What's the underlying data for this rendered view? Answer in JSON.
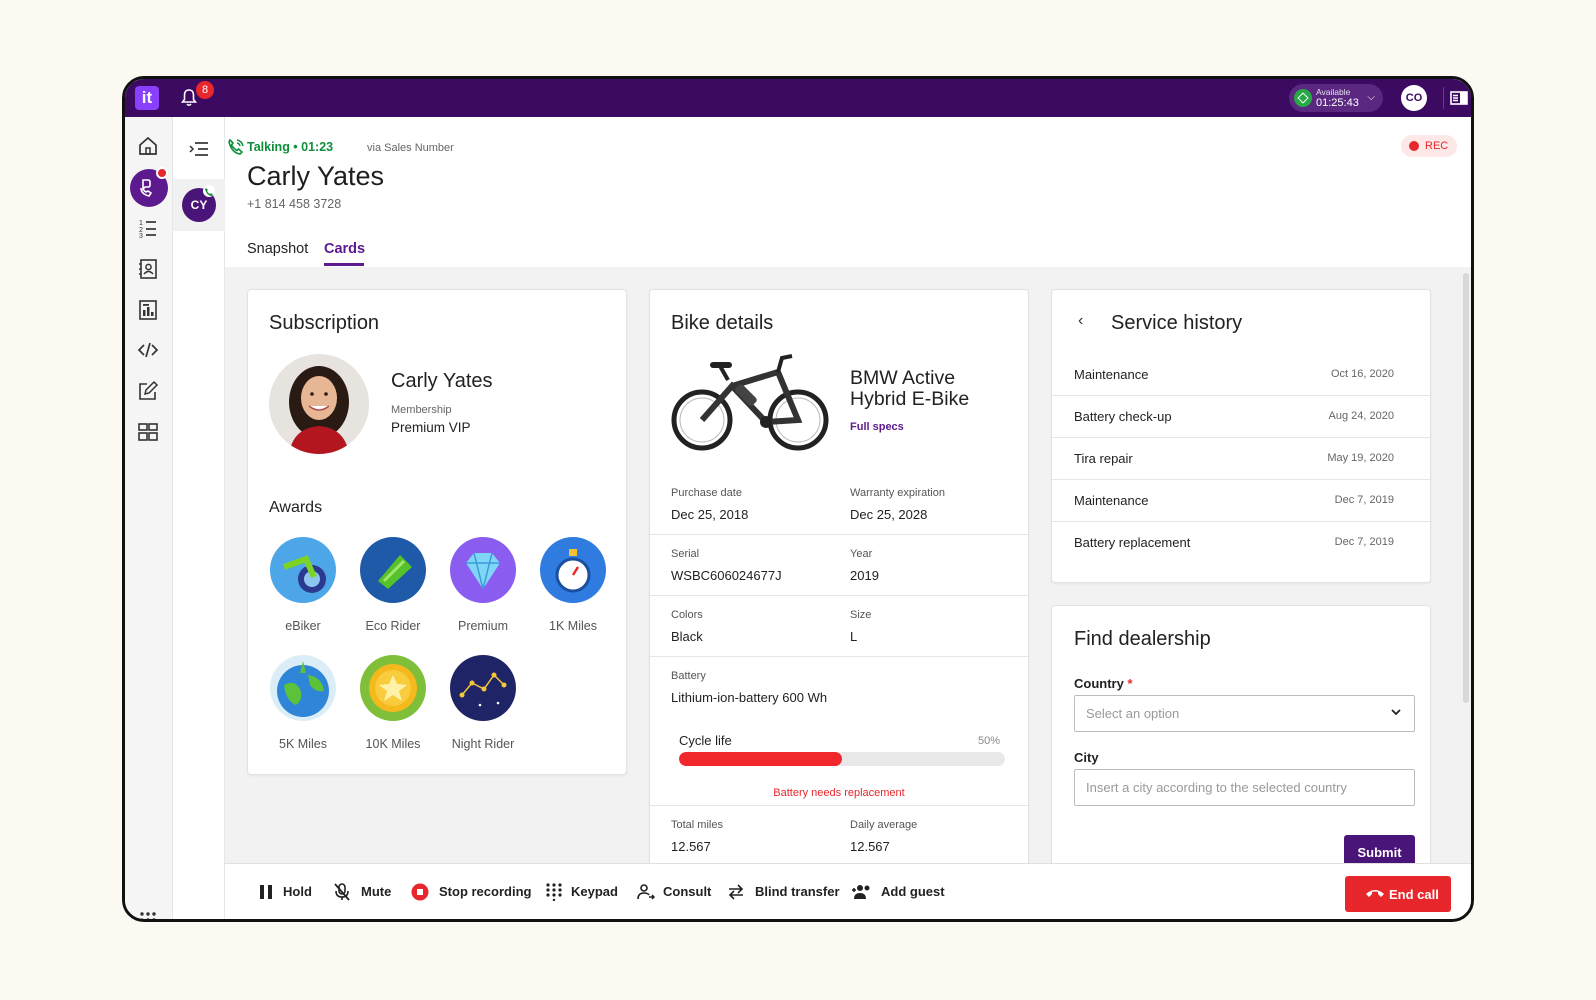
{
  "topbar": {
    "logo": "it",
    "notifications_count": "8",
    "status_label": "Available",
    "status_time": "01:25:43",
    "user_initials": "CO"
  },
  "call": {
    "status": "Talking • 01:23",
    "via": "via Sales Number",
    "contact_name": "Carly Yates",
    "phone": "+1 814 458 3728",
    "rec_label": "REC",
    "list_initials": "CY"
  },
  "tabs": [
    {
      "label": "Snapshot"
    },
    {
      "label": "Cards"
    }
  ],
  "subscription": {
    "title": "Subscription",
    "name": "Carly Yates",
    "membership_label": "Membership",
    "membership_value": "Premium VIP",
    "awards_title": "Awards",
    "awards": [
      {
        "label": "eBiker"
      },
      {
        "label": "Eco Rider"
      },
      {
        "label": "Premium"
      },
      {
        "label": "1K Miles"
      },
      {
        "label": "5K Miles"
      },
      {
        "label": "10K Miles"
      },
      {
        "label": "Night Rider"
      }
    ]
  },
  "bike": {
    "title": "Bike details",
    "name": "BMW Active Hybrid E-Bike",
    "full_specs": "Full specs",
    "purchase_date_label": "Purchase date",
    "purchase_date": "Dec 25, 2018",
    "warranty_label": "Warranty expiration",
    "warranty": "Dec 25, 2028",
    "serial_label": "Serial",
    "serial": "WSBC606024677J",
    "year_label": "Year",
    "year": "2019",
    "colors_label": "Colors",
    "colors": "Black",
    "size_label": "Size",
    "size": "L",
    "battery_label": "Battery",
    "battery": "Lithium-ion-battery 600 Wh",
    "cycle_label": "Cycle life",
    "cycle_pct_text": "50%",
    "cycle_fraction": 0.5,
    "battery_warning": "Battery needs replacement",
    "total_miles_label": "Total miles",
    "total_miles": "12.567",
    "daily_avg_label": "Daily average",
    "daily_avg": "12.567"
  },
  "service_history": {
    "title": "Service history",
    "items": [
      {
        "name": "Maintenance",
        "date": "Oct 16, 2020"
      },
      {
        "name": "Battery check-up",
        "date": "Aug 24, 2020"
      },
      {
        "name": "Tira repair",
        "date": "May 19, 2020"
      },
      {
        "name": "Maintenance",
        "date": "Dec 7, 2019"
      },
      {
        "name": "Battery replacement",
        "date": "Dec 7, 2019"
      }
    ]
  },
  "dealership": {
    "title": "Find dealership",
    "country_label": "Country",
    "required_mark": "*",
    "country_placeholder": "Select an option",
    "city_label": "City",
    "city_placeholder": "Insert a city according to the selected country",
    "submit_label": "Submit"
  },
  "bottombar": {
    "hold": "Hold",
    "mute": "Mute",
    "stop_recording": "Stop recording",
    "keypad": "Keypad",
    "consult": "Consult",
    "blind_transfer": "Blind transfer",
    "add_guest": "Add guest",
    "end_call": "End call"
  },
  "colors": {
    "brand_purple": "#3c0a61",
    "accent_purple": "#5d1a8f",
    "danger_red": "#e8272c",
    "talking_green": "#0e8f3b"
  }
}
